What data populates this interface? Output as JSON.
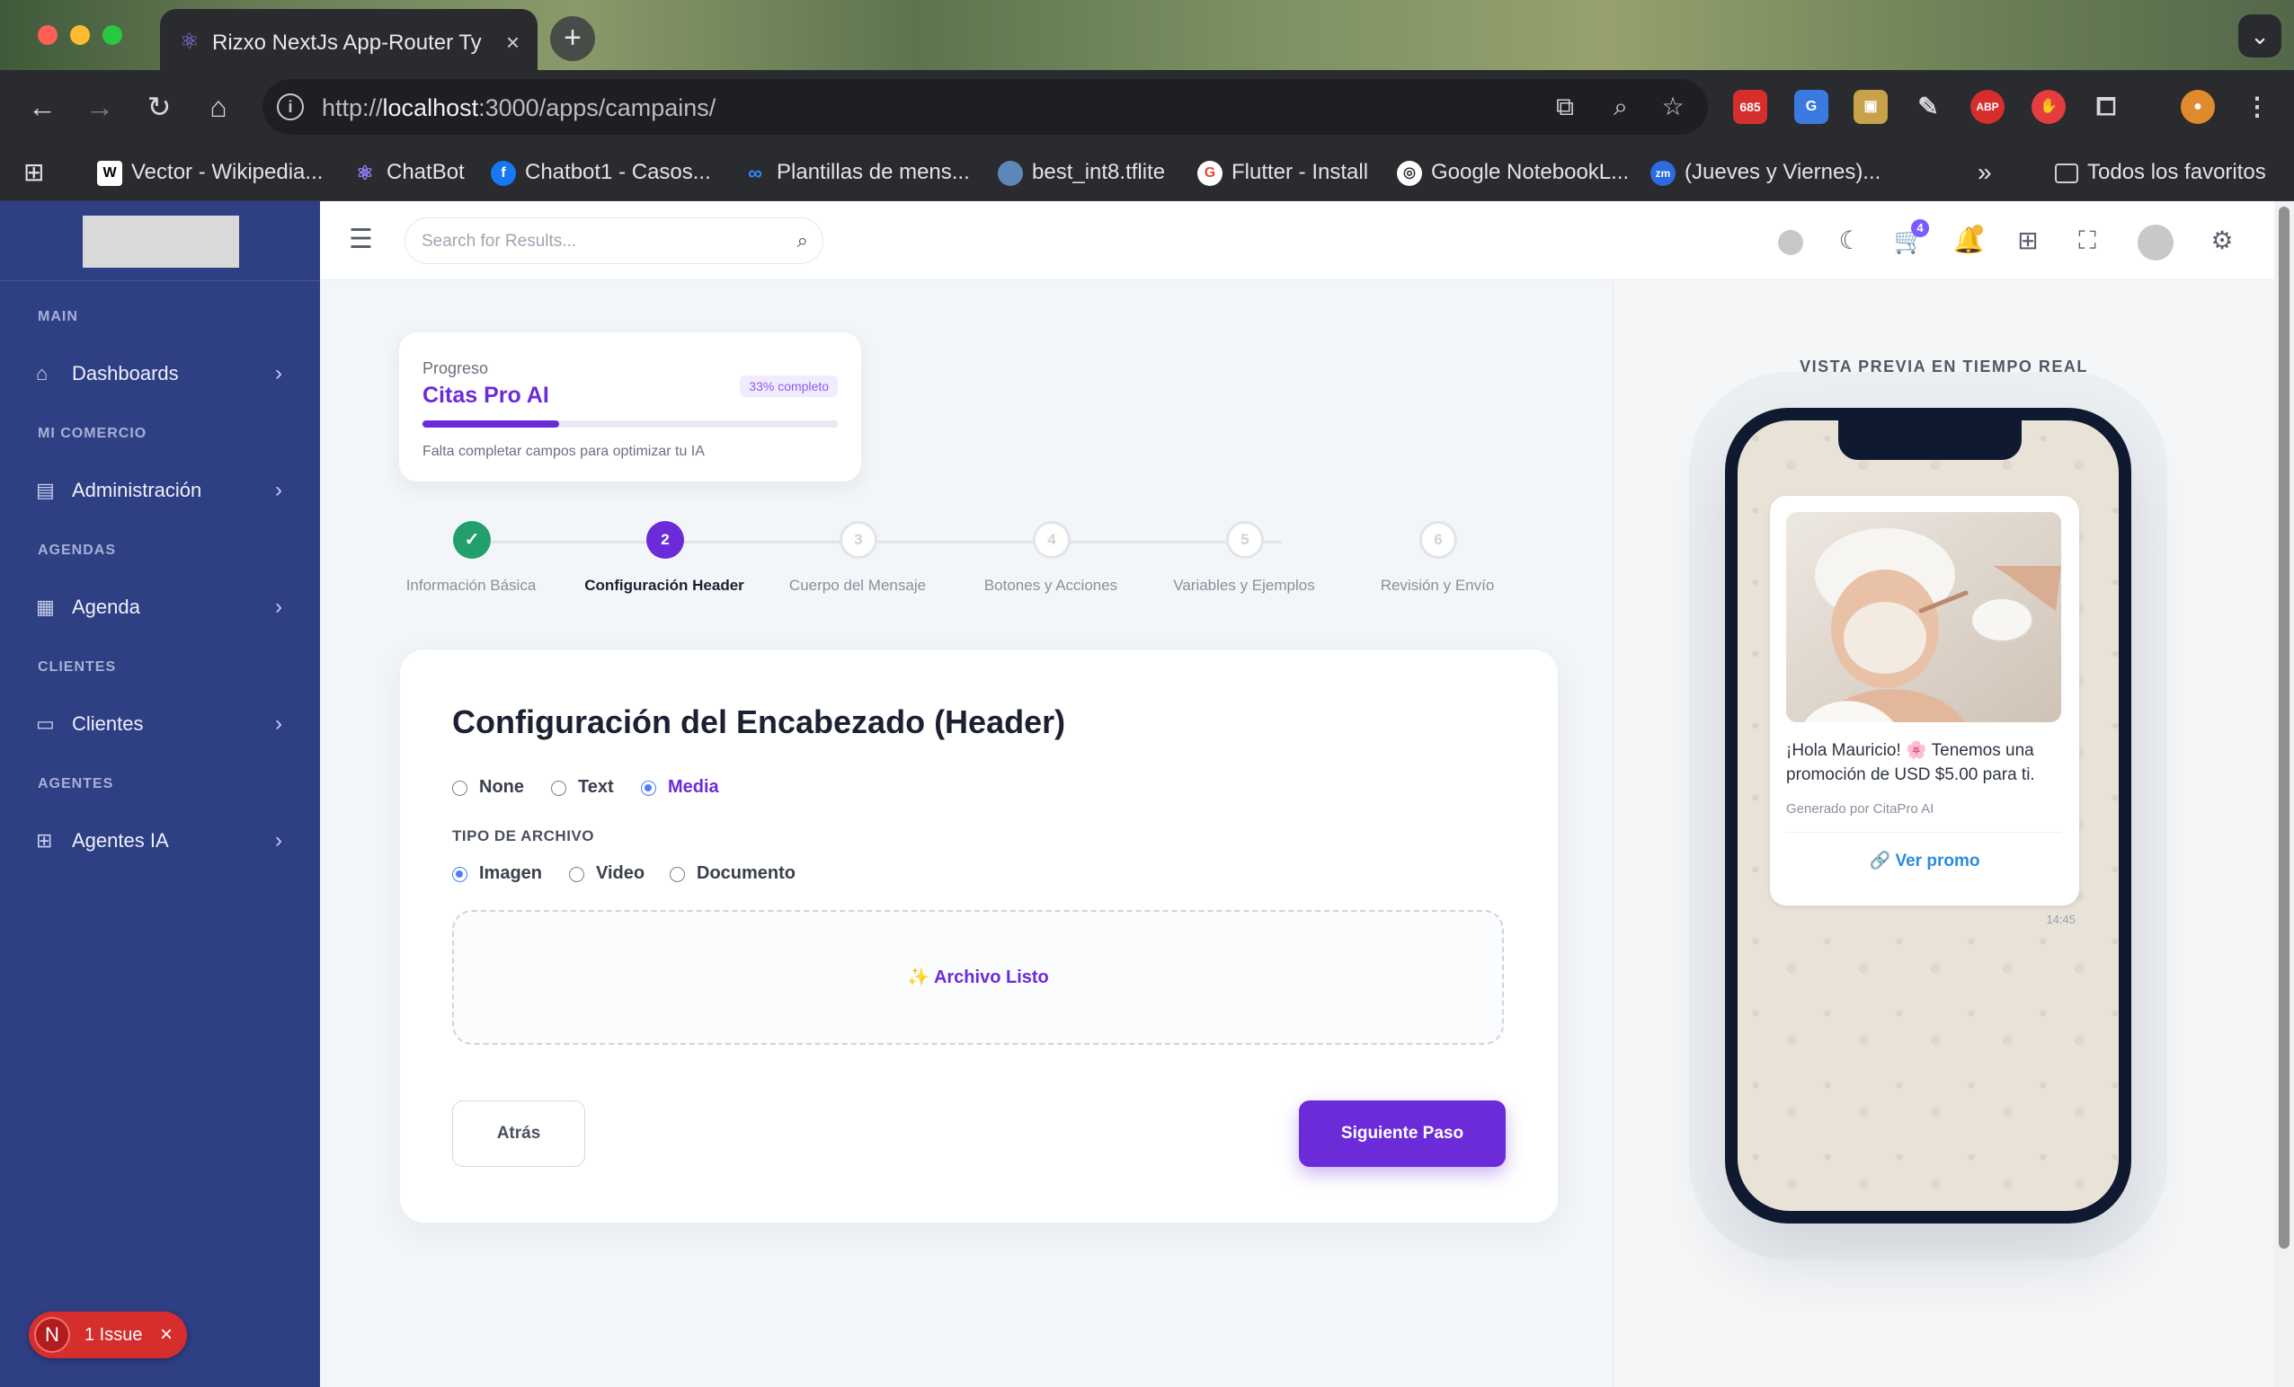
{
  "browser": {
    "tab_title": "Rizxo NextJs App-Router Typ",
    "url_prefix": "http://",
    "url_host": "localhost",
    "url_rest": ":3000/apps/campains/",
    "bookmarks": [
      {
        "label": "Vector - Wikipedia...",
        "icon": "wikipedia-icon"
      },
      {
        "label": "ChatBot",
        "icon": "chatbot-icon"
      },
      {
        "label": "Chatbot1 - Casos...",
        "icon": "facebook-icon"
      },
      {
        "label": "Plantillas de mens...",
        "icon": "meta-icon"
      },
      {
        "label": "best_int8.tflite",
        "icon": "globe-icon"
      },
      {
        "label": "Flutter - Install",
        "icon": "google-icon"
      },
      {
        "label": "Google NotebookL...",
        "icon": "notebooklm-icon"
      },
      {
        "label": "(Jueves y Viernes)...",
        "icon": "zoom-icon"
      }
    ],
    "all_favorites": "Todos los favoritos",
    "ext_badge": "685"
  },
  "sidebar": {
    "sections": [
      {
        "title": "MAIN",
        "item": "Dashboards",
        "icon": "home-icon"
      },
      {
        "title": "MI COMERCIO",
        "item": "Administración",
        "icon": "store-icon"
      },
      {
        "title": "AGENDAS",
        "item": "Agenda",
        "icon": "calendar-icon"
      },
      {
        "title": "CLIENTES",
        "item": "Clientes",
        "icon": "file-icon"
      },
      {
        "title": "AGENTES",
        "item": "Agentes IA",
        "icon": "grid-icon"
      }
    ]
  },
  "issue": {
    "letter": "N",
    "label": "1 Issue"
  },
  "topnav": {
    "search_placeholder": "Search for Results...",
    "cart_count": "4"
  },
  "progress": {
    "label": "Progreso",
    "title": "Citas Pro AI",
    "pill": "33% completo",
    "percent": 33,
    "note": "Falta completar campos para optimizar tu IA"
  },
  "steps": [
    {
      "num": "✓",
      "label": "Información Básica",
      "state": "done"
    },
    {
      "num": "2",
      "label": "Configuración Header",
      "state": "active"
    },
    {
      "num": "3",
      "label": "Cuerpo del Mensaje",
      "state": "todo"
    },
    {
      "num": "4",
      "label": "Botones y Acciones",
      "state": "todo"
    },
    {
      "num": "5",
      "label": "Variables y Ejemplos",
      "state": "todo"
    },
    {
      "num": "6",
      "label": "Revisión y Envío",
      "state": "todo"
    }
  ],
  "form": {
    "title": "Configuración del Encabezado (Header)",
    "header_options": [
      "None",
      "Text",
      "Media"
    ],
    "header_selected": "Media",
    "file_type_label": "TIPO DE ARCHIVO",
    "file_options": [
      "Imagen",
      "Video",
      "Documento"
    ],
    "file_selected": "Imagen",
    "dropzone_text": "✨ Archivo Listo",
    "back_label": "Atrás",
    "next_label": "Siguiente Paso"
  },
  "preview": {
    "title": "VISTA PREVIA EN TIEMPO REAL",
    "message": "¡Hola Mauricio! 🌸 Tenemos una promoción de USD $5.00 para ti.",
    "generated": "Generado por CitaPro AI",
    "link": "🔗 Ver promo",
    "time": "14:45"
  },
  "colors": {
    "accent": "#6c2bd9",
    "sidebar": "#2f3f84",
    "success": "#22a06b"
  }
}
